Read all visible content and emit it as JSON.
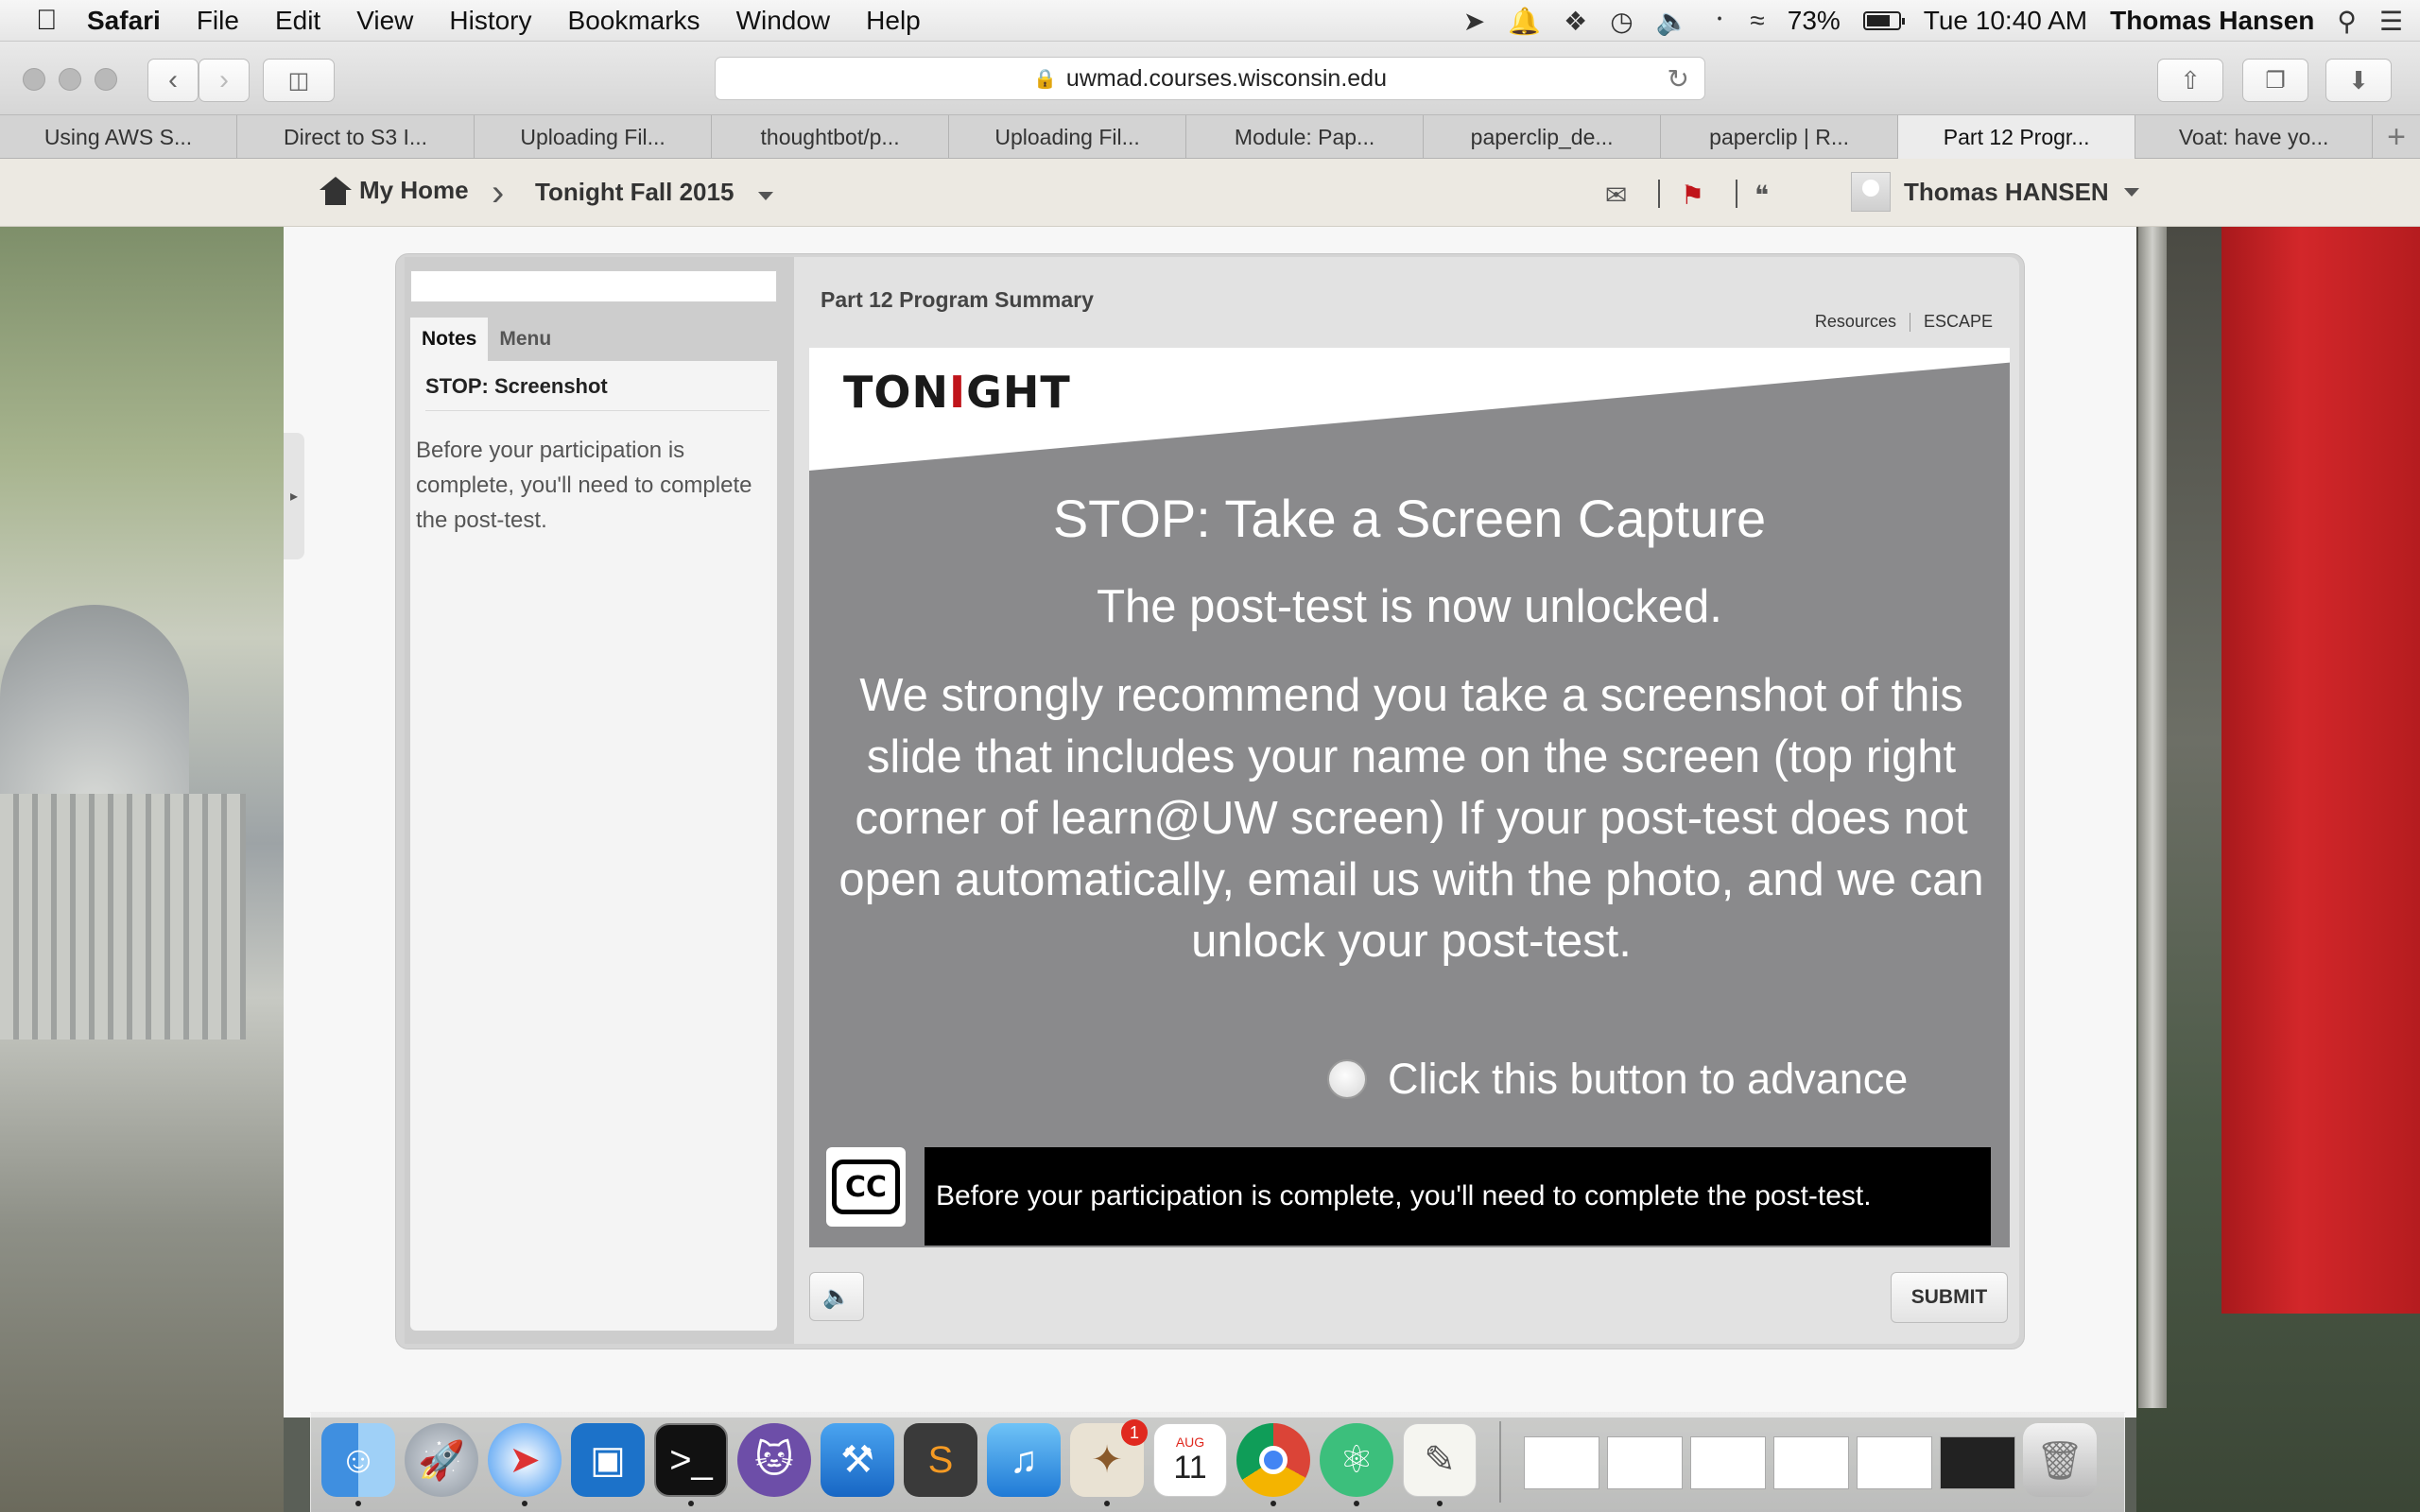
{
  "menubar": {
    "app": "Safari",
    "items": [
      "File",
      "Edit",
      "View",
      "History",
      "Bookmarks",
      "Window",
      "Help"
    ],
    "battery": "73%",
    "clock": "Tue 10:40 AM",
    "user": "Thomas Hansen"
  },
  "toolbar": {
    "url": "uwmad.courses.wisconsin.edu"
  },
  "tabs": [
    "Using AWS S...",
    "Direct to S3 I...",
    "Uploading Fil...",
    "thoughtbot/p...",
    "Uploading Fil...",
    "Module: Pap...",
    "paperclip_de...",
    "paperclip | R...",
    "Part 12 Progr...",
    "Voat: have yo..."
  ],
  "nav": {
    "home": "My Home",
    "course": "Tonight Fall 2015",
    "user": "Thomas HANSEN"
  },
  "sidebar": {
    "tab_notes": "Notes",
    "tab_menu": "Menu",
    "title": "STOP:  Screenshot",
    "text": "Before your participation is complete, you'll need to complete the post-test."
  },
  "player": {
    "title": "Part 12 Program Summary",
    "resources": "Resources",
    "escape": "ESCAPE",
    "submit": "SUBMIT"
  },
  "slide": {
    "logo_pre": "TON",
    "logo_i": "I",
    "logo_post": "GHT",
    "heading": "STOP: Take a Screen Capture",
    "subheading": "The post-test is now unlocked.",
    "body": "We strongly recommend you take a screenshot of this slide that includes your name on the screen (top right corner of learn@UW screen)   If your post-test does not open automatically, email us with the photo, and we can unlock your post-test.",
    "advance": "Click this button to advance",
    "cc": "CC",
    "caption": "Before your participation is complete, you'll need to complete the post-test."
  },
  "dock": {
    "calendar_month": "AUG",
    "calendar_day": "11",
    "mail_badge": "1"
  },
  "colors": {
    "slide_bg": "#8a8a8c",
    "brand_red": "#c0151b",
    "banner_red": "#d3272a"
  }
}
